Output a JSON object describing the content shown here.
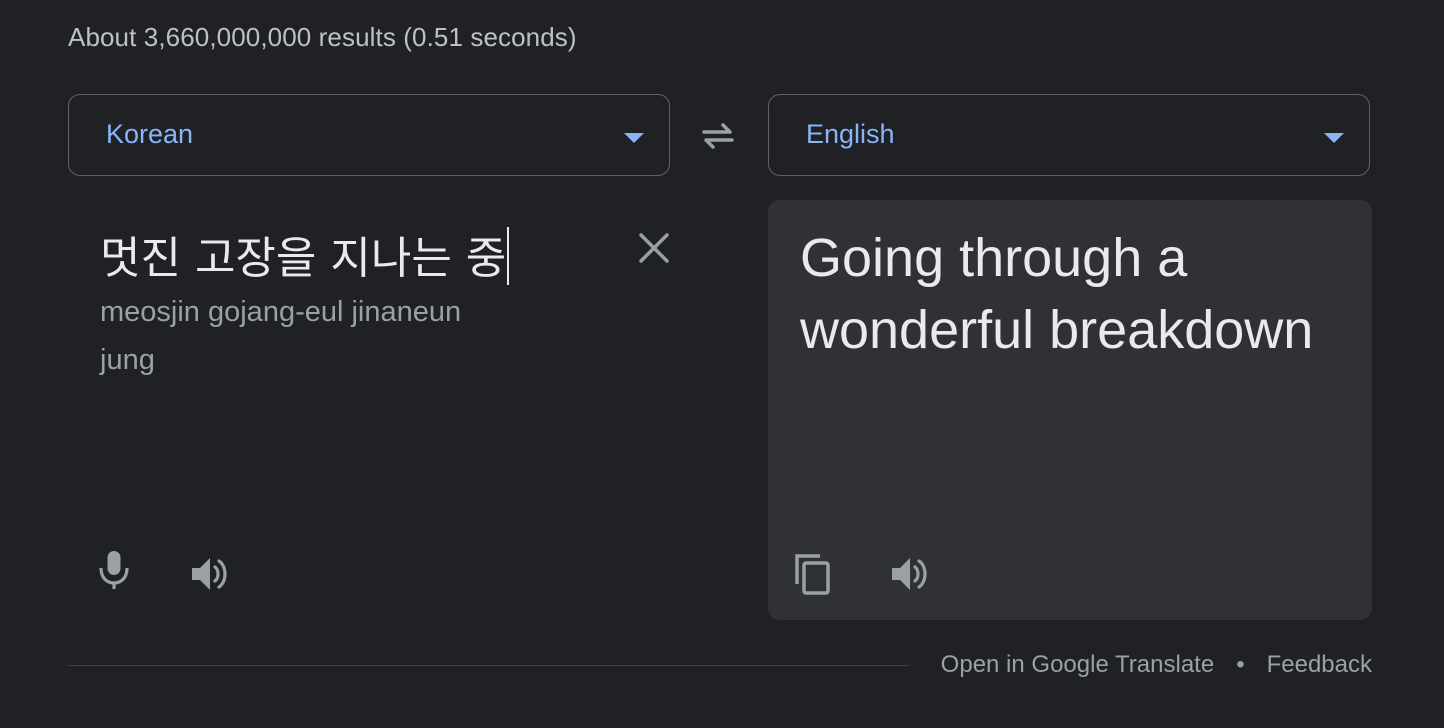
{
  "results_stats": "About 3,660,000,000 results (0.51 seconds)",
  "source_language": {
    "label": "Korean",
    "icon": "arrow-drop-down-icon"
  },
  "target_language": {
    "label": "English",
    "icon": "arrow-drop-down-icon"
  },
  "swap_icon": "swap-languages-icon",
  "source": {
    "text": "멋진 고장을 지나는 중",
    "transliteration": "meosjin gojang-eul jinaneun jung",
    "icons": [
      "clear-icon",
      "microphone-icon",
      "speaker-icon"
    ]
  },
  "target": {
    "text": "Going through a wonderful breakdown",
    "icons": [
      "copy-icon",
      "speaker-icon"
    ]
  },
  "footer": {
    "open_link": "Open in Google Translate",
    "separator": "•",
    "feedback_link": "Feedback"
  },
  "colors": {
    "background": "#202124",
    "accent": "#8ab4f8",
    "output_panel": "#303134",
    "icon": "#9aa0a6"
  }
}
